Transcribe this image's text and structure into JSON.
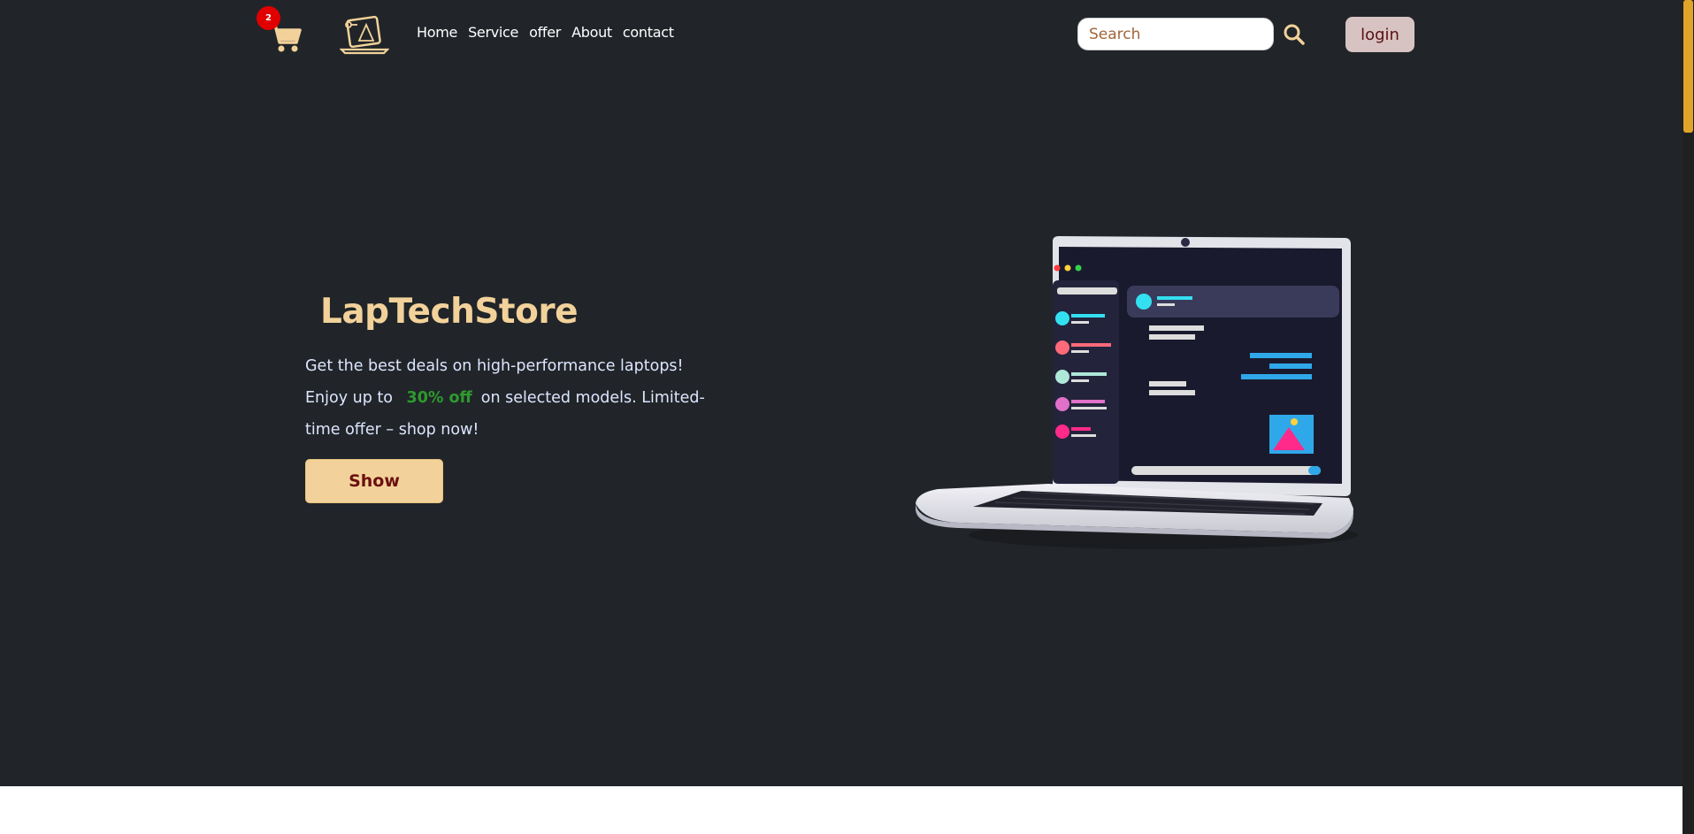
{
  "navbar": {
    "cart_count": "2",
    "links": [
      "Home",
      "Service",
      "offer",
      "About",
      "contact"
    ],
    "search_placeholder": "Search",
    "login_label": "login"
  },
  "hero": {
    "title": "LapTechStore",
    "tagline_part1": "Get the best deals on high-performance laptops! Enjoy up to",
    "tagline_highlight": "30% off",
    "tagline_part2": "on selected models. Limited-time offer – shop now!",
    "button_label": "Show"
  },
  "colors": {
    "background": "#212529",
    "accent": "#f2d29a",
    "highlight": "#2e9a2e",
    "badge": "#e00000",
    "scroll_thumb": "#e0a528"
  },
  "icons": {
    "cart": "cart-icon",
    "logo": "laptop-logo-icon",
    "search": "search-icon"
  }
}
